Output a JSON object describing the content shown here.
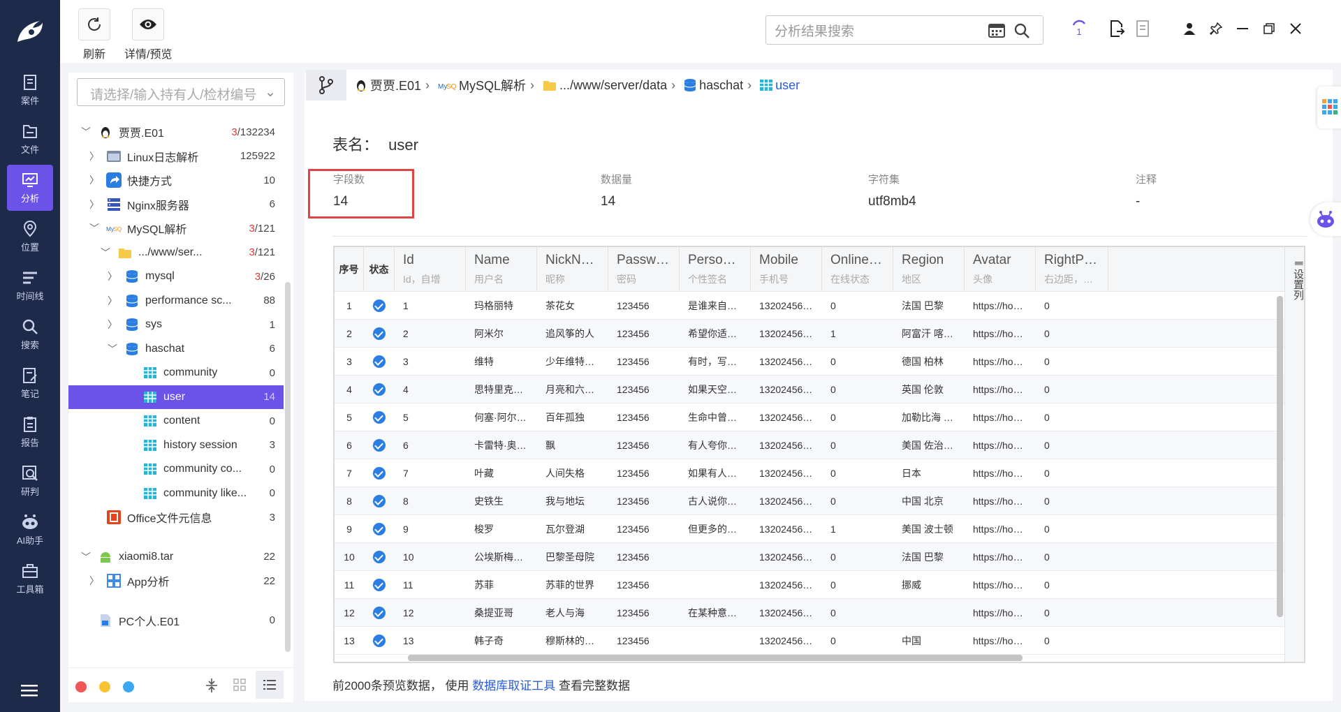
{
  "nav": {
    "items": [
      {
        "label": "案件",
        "icon": "case-icon"
      },
      {
        "label": "文件",
        "icon": "file-icon"
      },
      {
        "label": "分析",
        "icon": "analysis-icon",
        "active": true
      },
      {
        "label": "位置",
        "icon": "location-icon"
      },
      {
        "label": "时间线",
        "icon": "timeline-icon"
      },
      {
        "label": "搜索",
        "icon": "search-icon"
      },
      {
        "label": "笔记",
        "icon": "note-icon"
      },
      {
        "label": "报告",
        "icon": "report-icon"
      },
      {
        "label": "研判",
        "icon": "judge-icon"
      },
      {
        "label": "AI助手",
        "icon": "ai-icon"
      },
      {
        "label": "工具箱",
        "icon": "toolbox-icon"
      }
    ]
  },
  "toolbar": {
    "refresh_label": "刷新",
    "detail_label": "详情/预览",
    "search_placeholder": "分析结果搜索",
    "task_count": "1"
  },
  "tree": {
    "holder_placeholder": "请选择/输入持有人/检材编号",
    "nodes": [
      {
        "label": "贾贾.E01",
        "count_red": "3",
        "count": "/132234",
        "level": 0,
        "chev": "down",
        "icon": "linux-icon"
      },
      {
        "label": "Linux日志解析",
        "count": "125922",
        "level": 1,
        "chev": "right",
        "icon": "log-icon"
      },
      {
        "label": "快捷方式",
        "count": "10",
        "level": 1,
        "chev": "right",
        "icon": "shortcut-icon"
      },
      {
        "label": "Nginx服务器",
        "count": "6",
        "level": 1,
        "chev": "right",
        "icon": "server-icon"
      },
      {
        "label": "MySQL解析",
        "count_red": "3",
        "count": "/121",
        "level": 1,
        "chev": "down",
        "icon": "mysql-icon"
      },
      {
        "label": ".../www/ser...",
        "count_red": "3",
        "count": "/121",
        "level": 2,
        "chev": "down",
        "icon": "folder-icon"
      },
      {
        "label": "mysql",
        "count_red": "3",
        "count": "/26",
        "level": 3,
        "chev": "right",
        "icon": "database-icon"
      },
      {
        "label": "performance sc...",
        "count": "88",
        "level": 3,
        "chev": "right",
        "icon": "database-icon"
      },
      {
        "label": "sys",
        "count": "1",
        "level": 3,
        "chev": "right",
        "icon": "database-icon"
      },
      {
        "label": "haschat",
        "count": "6",
        "level": 3,
        "chev": "down",
        "icon": "database-icon"
      },
      {
        "label": "community",
        "count": "0",
        "level": 4,
        "icon": "table-icon"
      },
      {
        "label": "user",
        "count": "14",
        "level": 4,
        "icon": "table-icon",
        "selected": true
      },
      {
        "label": "content",
        "count": "0",
        "level": 4,
        "icon": "table-icon"
      },
      {
        "label": "history session",
        "count": "3",
        "level": 4,
        "icon": "table-icon"
      },
      {
        "label": "community co...",
        "count": "0",
        "level": 4,
        "icon": "table-icon"
      },
      {
        "label": "community like...",
        "count": "0",
        "level": 4,
        "icon": "table-icon"
      },
      {
        "label": "Office文件元信息",
        "count": "3",
        "level": 1,
        "icon": "office-icon"
      },
      {
        "label": "xiaomi8.tar",
        "count": "22",
        "level": 0,
        "chev": "down",
        "icon": "android-icon",
        "gap": true
      },
      {
        "label": "App分析",
        "count": "22",
        "level": 1,
        "chev": "right",
        "icon": "app-icon"
      },
      {
        "label": "PC个人.E01",
        "count": "0",
        "level": 0,
        "icon": "pc-icon",
        "gap": true
      }
    ]
  },
  "breadcrumb": [
    {
      "label": "贾贾.E01",
      "icon": "linux-icon"
    },
    {
      "label": "MySQL解析",
      "icon": "mysql-icon"
    },
    {
      "label": ".../www/server/data",
      "icon": "folder-icon"
    },
    {
      "label": "haschat",
      "icon": "database-icon"
    },
    {
      "label": "user",
      "icon": "table-icon",
      "current": true
    }
  ],
  "table_info": {
    "title_label": "表名：",
    "title_value": "user",
    "fields_label": "字段数",
    "fields_value": "14",
    "rows_label": "数据量",
    "rows_value": "14",
    "charset_label": "字符集",
    "charset_value": "utf8mb4",
    "comment_label": "注释",
    "comment_value": "-"
  },
  "grid": {
    "index_header": "序号",
    "status_header": "状态",
    "columns": [
      {
        "name": "Id",
        "sub": "Id，自增"
      },
      {
        "name": "Name",
        "sub": "用户名"
      },
      {
        "name": "NickName",
        "sub": "昵称"
      },
      {
        "name": "Password",
        "sub": "密码"
      },
      {
        "name": "Personali...",
        "sub": "个性签名"
      },
      {
        "name": "Mobile",
        "sub": "手机号"
      },
      {
        "name": "OnlineSt...",
        "sub": "在线状态"
      },
      {
        "name": "Region",
        "sub": "地区"
      },
      {
        "name": "Avatar",
        "sub": "头像"
      },
      {
        "name": "RightPad...",
        "sub": "右边距，仅..."
      }
    ],
    "settings_label": "设置列",
    "rows": [
      [
        "1",
        "1",
        "玛格丽特",
        "茶花女",
        "123456",
        "是谁来自山...",
        "1320245621X",
        "0",
        "法国 巴黎",
        "https://howc...",
        "0"
      ],
      [
        "2",
        "2",
        "阿米尔",
        "追风筝的人",
        "123456",
        "希望你适应...",
        "1320245621X",
        "1",
        "阿富汗 喀布尔",
        "https://howc...",
        "0"
      ],
      [
        "3",
        "3",
        "维特",
        "少年维特的...",
        "123456",
        "有时，写的...",
        "1320245621X",
        "0",
        "德国 柏林",
        "https://howc...",
        "0"
      ],
      [
        "4",
        "4",
        "思特里克兰德",
        "月亮和六便士",
        "123456",
        "如果天空是...",
        "1320245621X",
        "0",
        "英国 伦敦",
        "https://howc...",
        "0"
      ],
      [
        "5",
        "5",
        "何塞·阿尔卡...",
        "百年孤独",
        "123456",
        "生命中曾经...",
        "1320245621X",
        "0",
        "加勒比海 马...",
        "https://howc...",
        "0"
      ],
      [
        "6",
        "6",
        "卡雷特·奥哈拉",
        "飘",
        "123456",
        "有人夸你优...",
        "1320245621X",
        "0",
        "美国 佐治亚州",
        "https://howc...",
        "0"
      ],
      [
        "7",
        "7",
        "叶藏",
        "人间失格",
        "123456",
        "如果有人在...",
        "1320245621X",
        "0",
        "日本",
        "https://howc...",
        "0"
      ],
      [
        "8",
        "8",
        "史铁生",
        "我与地坛",
        "123456",
        "古人说你不...",
        "1320245621X",
        "0",
        "中国 北京",
        "https://howc...",
        "0"
      ],
      [
        "9",
        "9",
        "梭罗",
        "瓦尔登湖",
        "123456",
        "但更多的时...",
        "1320245621X",
        "1",
        "美国 波士顿",
        "https://howc...",
        "0"
      ],
      [
        "10",
        "10",
        "公埃斯梅拉达",
        "巴黎圣母院",
        "123456",
        "",
        "1320245621X",
        "0",
        "法国 巴黎",
        "https://howc...",
        "0"
      ],
      [
        "11",
        "11",
        "苏菲",
        "苏菲的世界",
        "123456",
        "",
        "1320245621X",
        "0",
        "挪威",
        "https://howc...",
        "0"
      ],
      [
        "12",
        "12",
        "桑提亚哥",
        "老人与海",
        "123456",
        "在某种意义...",
        "1320245621X",
        "0",
        "",
        "https://howc...",
        "0"
      ],
      [
        "13",
        "13",
        "韩子奇",
        "穆斯林的葬礼",
        "123456",
        "",
        "1320245621X",
        "0",
        "中国",
        "https://howc...",
        "0"
      ]
    ]
  },
  "footer": {
    "prefix": "前2000条预览数据，  使用 ",
    "link": "数据库取证工具",
    "suffix": " 查看完整数据"
  },
  "colors": {
    "nav_bg": "#1e2a4a",
    "accent": "#6b52e8",
    "highlight": "#e04545",
    "check": "#2a7de1"
  }
}
